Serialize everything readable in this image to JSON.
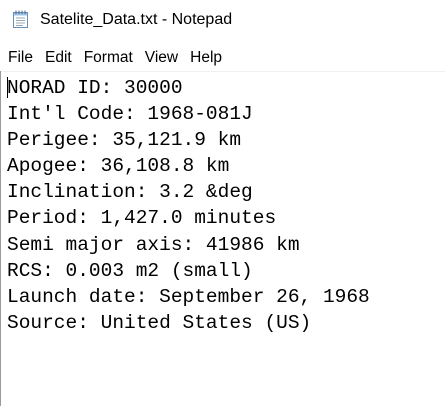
{
  "window": {
    "title": "Satelite_Data.txt - Notepad",
    "icon": "notepad-icon"
  },
  "menu": {
    "file": "File",
    "edit": "Edit",
    "format": "Format",
    "view": "View",
    "help": "Help"
  },
  "document": {
    "lines": [
      "NORAD ID: 30000",
      "Int'l Code: 1968-081J",
      "Perigee: 35,121.9 km",
      "Apogee: 36,108.8 km",
      "Inclination: 3.2 &deg",
      "Period: 1,427.0 minutes",
      "Semi major axis: 41986 km",
      "RCS: 0.003 m2 (small)",
      "Launch date: September 26, 1968",
      "Source: United States (US)"
    ]
  }
}
